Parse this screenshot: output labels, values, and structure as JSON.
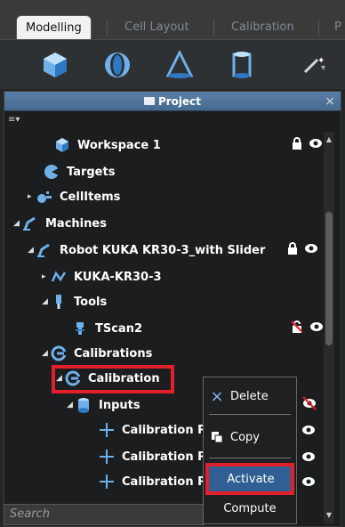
{
  "tabs": [
    {
      "label": "Modelling",
      "active": true
    },
    {
      "label": "Cell Layout",
      "active": false
    },
    {
      "label": "Calibration",
      "active": false
    },
    {
      "label": "P",
      "active": false
    }
  ],
  "toolbar": {
    "tools": [
      "cube-icon",
      "sphere-icon",
      "cone-icon",
      "cylinder-icon",
      "magic-wand-icon"
    ]
  },
  "panel": {
    "title": "Project",
    "close": "×",
    "menu": "≡▾"
  },
  "tree": [
    {
      "label": "Workspace 1",
      "icon": "workspace-icon",
      "lock": true,
      "eye": true
    },
    {
      "label": "Targets",
      "icon": "targets-icon"
    },
    {
      "label": "CellItems",
      "icon": "cellitems-icon",
      "arrow": "▸"
    },
    {
      "label": "Machines",
      "icon": "machines-icon",
      "arrow": "◢"
    },
    {
      "label": "Robot  KUKA KR30-3_with Slider",
      "icon": "robot-icon",
      "arrow": "◢",
      "lock": true,
      "eye": true
    },
    {
      "label": "KUKA-KR30-3",
      "icon": "kinematics-icon",
      "arrow": "▸"
    },
    {
      "label": "Tools",
      "icon": "tool-icon",
      "arrow": "◢"
    },
    {
      "label": "TScan2",
      "icon": "scanner-icon",
      "unlock": true,
      "eye": true
    },
    {
      "label": "Calibrations",
      "icon": "calibrations-icon",
      "arrow": "◢"
    },
    {
      "label": "Calibration",
      "icon": "calibration-icon",
      "arrow": "◢"
    },
    {
      "label": "Inputs",
      "icon": "inputs-icon",
      "arrow": "◢",
      "hidden": true
    },
    {
      "label": "Calibration P",
      "icon": "plus-icon",
      "eye": true
    },
    {
      "label": "Calibration P",
      "icon": "plus-icon",
      "eye": true
    },
    {
      "label": "Calibration P",
      "icon": "plus-icon",
      "eye": true
    }
  ],
  "search": {
    "placeholder": "Search"
  },
  "context_menu": {
    "items": [
      {
        "label": "Delete",
        "icon": "×"
      },
      {
        "label": "Copy",
        "icon": "copy"
      },
      {
        "label": "Activate"
      },
      {
        "label": "Compute"
      }
    ]
  },
  "colors": {
    "highlight": "#e21f2a",
    "activate_bg": "#2f5f93",
    "panel_title": "#4f7399"
  }
}
